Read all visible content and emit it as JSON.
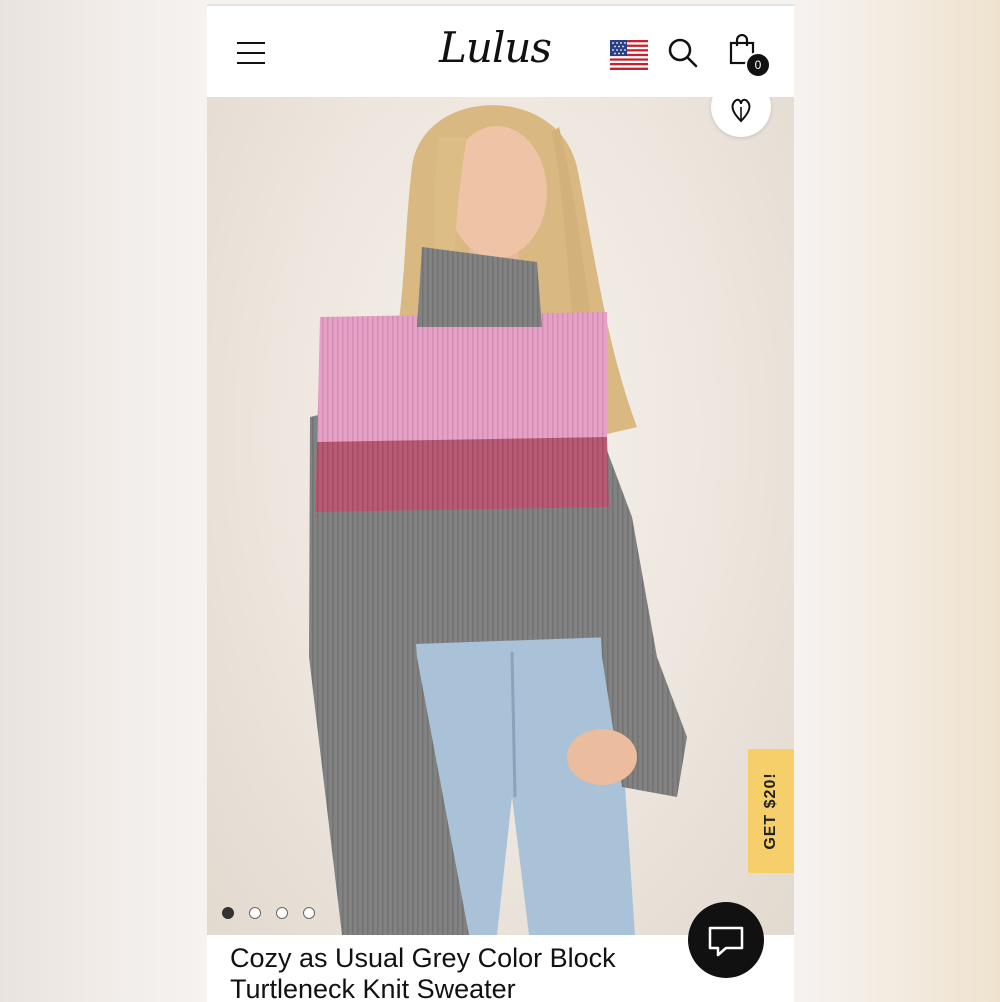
{
  "header": {
    "logo_text": "Lulus",
    "menu_icon": "hamburger-menu-icon",
    "flag_icon": "us-flag-icon",
    "search_icon": "search-icon",
    "cart_icon": "shopping-bag-icon",
    "cart_count": "0"
  },
  "product": {
    "title": "Cozy as Usual Grey Color Block Turtleneck Knit Sweater",
    "image_count": 4,
    "active_image": 1
  },
  "promo": {
    "label": "GET $20!",
    "color": "#f7cf6a"
  },
  "chat": {
    "icon": "chat-bubble-icon"
  },
  "wishlist": {
    "icon": "heart-icon"
  },
  "colors": {
    "sweater_grey": "#808080",
    "sweater_pink": "#e39ac0",
    "sweater_rose": "#b5576f",
    "denim": "#a9c2d8"
  }
}
